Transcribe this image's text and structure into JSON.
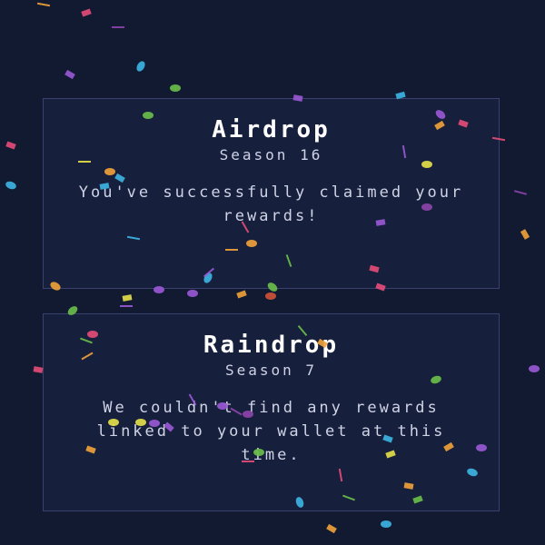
{
  "cards": [
    {
      "title": "Airdrop",
      "season": "Season 16",
      "message": "You've successfully claimed your rewards!"
    },
    {
      "title": "Raindrop",
      "season": "Season 7",
      "message": "We couldn't find any rewards linked to your wallet at this time."
    }
  ],
  "colors": {
    "background": "#111a31",
    "card_background": "#161f3b",
    "card_border": "#3a4170",
    "title": "#ffffff",
    "text": "#cfd3e6",
    "confetti": [
      "#9b59d6",
      "#e84c7a",
      "#f2a33a",
      "#3db5e6",
      "#6cc04a",
      "#e8e14a",
      "#8e44ad",
      "#d2533a"
    ]
  }
}
